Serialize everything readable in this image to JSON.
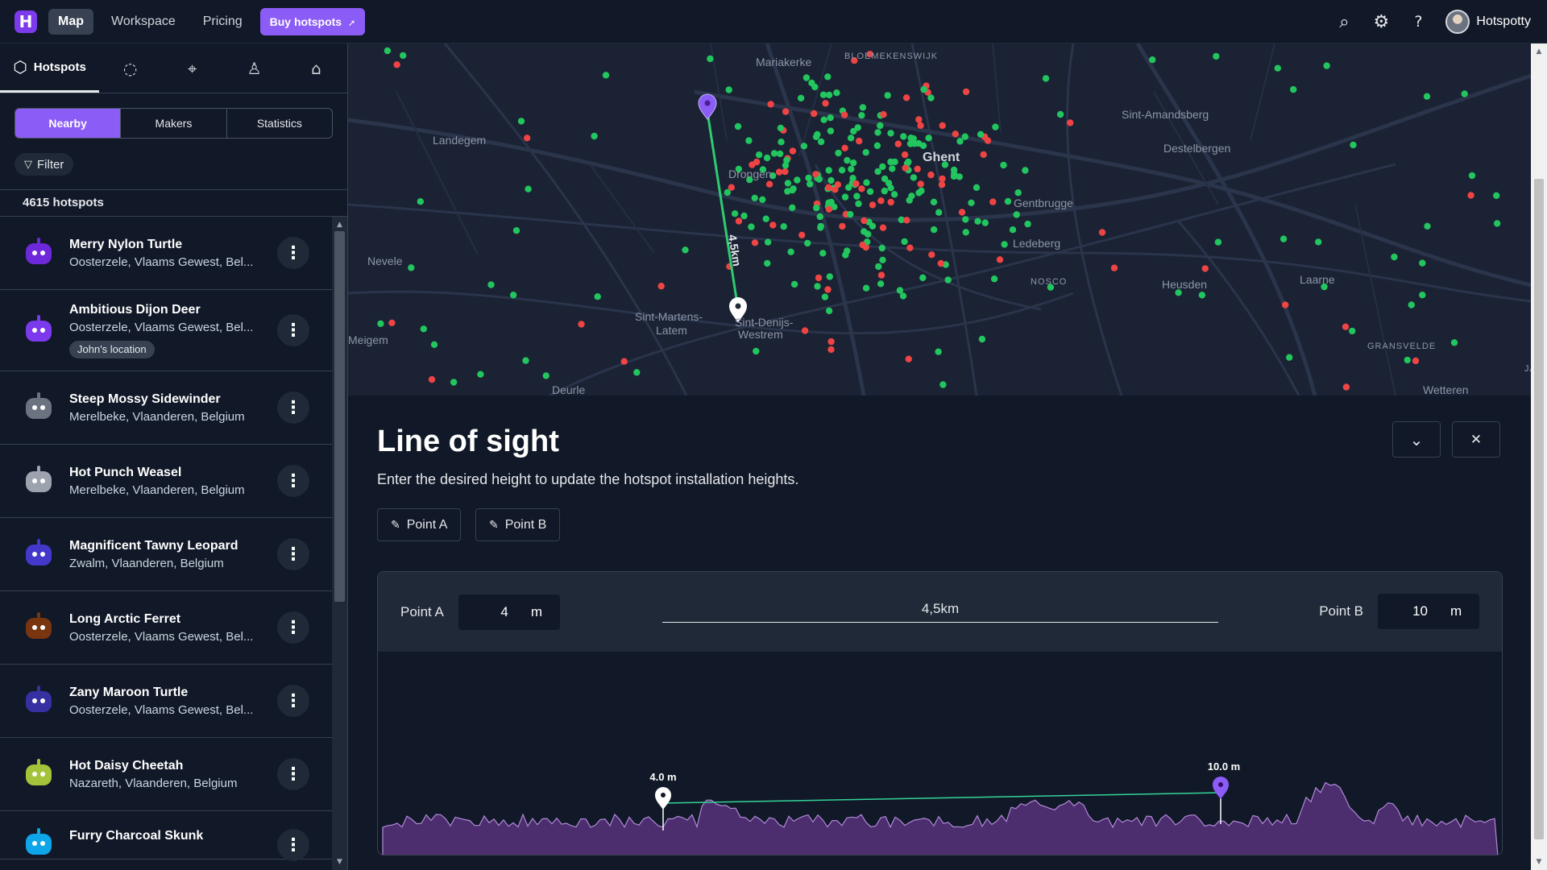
{
  "topbar": {
    "logo_letter": "H",
    "nav": [
      "Map",
      "Workspace",
      "Pricing"
    ],
    "buy_label": "Buy hotspots",
    "buy_icon": "rocket-icon",
    "search_icon": "⌕",
    "settings_icon": "⚙",
    "help_icon": "?",
    "user_name": "Hotspotty"
  },
  "sidebar": {
    "tabs": [
      {
        "icon": "cube-icon",
        "glyph": "⬡",
        "label": "Hotspots"
      },
      {
        "icon": "circle-dashed-icon",
        "glyph": "◌",
        "label": ""
      },
      {
        "icon": "map-pin-icon",
        "glyph": "⌖",
        "label": ""
      },
      {
        "icon": "user-icon",
        "glyph": "♙",
        "label": ""
      },
      {
        "icon": "home-icon",
        "glyph": "⌂",
        "label": ""
      }
    ],
    "segments": [
      "Nearby",
      "Makers",
      "Statistics"
    ],
    "filter_label": "Filter",
    "filter_glyph": "▽",
    "count": "4615 hotspots",
    "items": [
      {
        "name": "Merry Nylon Turtle",
        "location": "Oosterzele, Vlaams Gewest, Bel...",
        "color": "#6d28d9",
        "tag": ""
      },
      {
        "name": "Ambitious Dijon Deer",
        "location": "Oosterzele, Vlaams Gewest, Bel...",
        "color": "#7c3aed",
        "tag": "John's location"
      },
      {
        "name": "Steep Mossy Sidewinder",
        "location": "Merelbeke, Vlaanderen, Belgium",
        "color": "#6b7280",
        "tag": ""
      },
      {
        "name": "Hot Punch Weasel",
        "location": "Merelbeke, Vlaanderen, Belgium",
        "color": "#9ca3af",
        "tag": ""
      },
      {
        "name": "Magnificent Tawny Leopard",
        "location": "Zwalm, Vlaanderen, Belgium",
        "color": "#4338ca",
        "tag": ""
      },
      {
        "name": "Long Arctic Ferret",
        "location": "Oosterzele, Vlaams Gewest, Bel...",
        "color": "#78350f",
        "tag": ""
      },
      {
        "name": "Zany Maroon Turtle",
        "location": "Oosterzele, Vlaams Gewest, Bel...",
        "color": "#3730a3",
        "tag": ""
      },
      {
        "name": "Hot Daisy Cheetah",
        "location": "Nazareth, Vlaanderen, Belgium",
        "color": "#a3c43a",
        "tag": ""
      },
      {
        "name": "Furry Charcoal Skunk",
        "location": "",
        "color": "#0ea5e9",
        "tag": ""
      }
    ]
  },
  "map": {
    "labels": [
      {
        "text": "Landegem",
        "cls": ""
      },
      {
        "text": "Nevele",
        "cls": ""
      },
      {
        "text": "Drongen",
        "cls": ""
      },
      {
        "text": "Ghent",
        "cls": "city"
      },
      {
        "text": "Gentbrugge",
        "cls": ""
      },
      {
        "text": "Destelbergen",
        "cls": ""
      },
      {
        "text": "Sint-Martens-",
        "cls": ""
      },
      {
        "text": "Latem",
        "cls": ""
      },
      {
        "text": "Sint-Denijs-",
        "cls": ""
      },
      {
        "text": "Westrem",
        "cls": ""
      },
      {
        "text": "Ledeberg",
        "cls": ""
      },
      {
        "text": "Heusden",
        "cls": ""
      },
      {
        "text": "Laarne",
        "cls": ""
      },
      {
        "text": "GRANSVELDE",
        "cls": "small"
      },
      {
        "text": "Wetteren",
        "cls": ""
      },
      {
        "text": "JABEKE",
        "cls": "small"
      },
      {
        "text": "Mariakerke",
        "cls": ""
      },
      {
        "text": "BLOEMEKENSWIJK",
        "cls": "small"
      },
      {
        "text": "Sint-Amandsberg",
        "cls": ""
      },
      {
        "text": "Deurle",
        "cls": ""
      },
      {
        "text": "Meigem",
        "cls": ""
      },
      {
        "text": "NOSCO",
        "cls": "small"
      }
    ],
    "distance_label": "4,5km",
    "colors": {
      "online": "#22c55e",
      "offline": "#ef4444",
      "line": "#2ecc71",
      "pin_a": "#ffffff",
      "pin_b": "#8b5cf6"
    }
  },
  "los": {
    "title": "Line of sight",
    "subtitle": "Enter the desired height to update the hotspot installation heights.",
    "point_a_btn": "Point A",
    "point_b_btn": "Point B",
    "pencil": "✎",
    "collapse_glyph": "⌄",
    "close_glyph": "✕",
    "point_a_label": "Point A",
    "point_a_value": "4",
    "point_b_label": "Point B",
    "point_b_value": "10",
    "unit": "m",
    "distance": "4,5km",
    "marker_a_label": "4.0 m",
    "marker_b_label": "10.0 m",
    "colors": {
      "terrain": "#4c2d6e",
      "terrain_edge": "#b08ad8",
      "sight_line": "#34d399"
    }
  }
}
